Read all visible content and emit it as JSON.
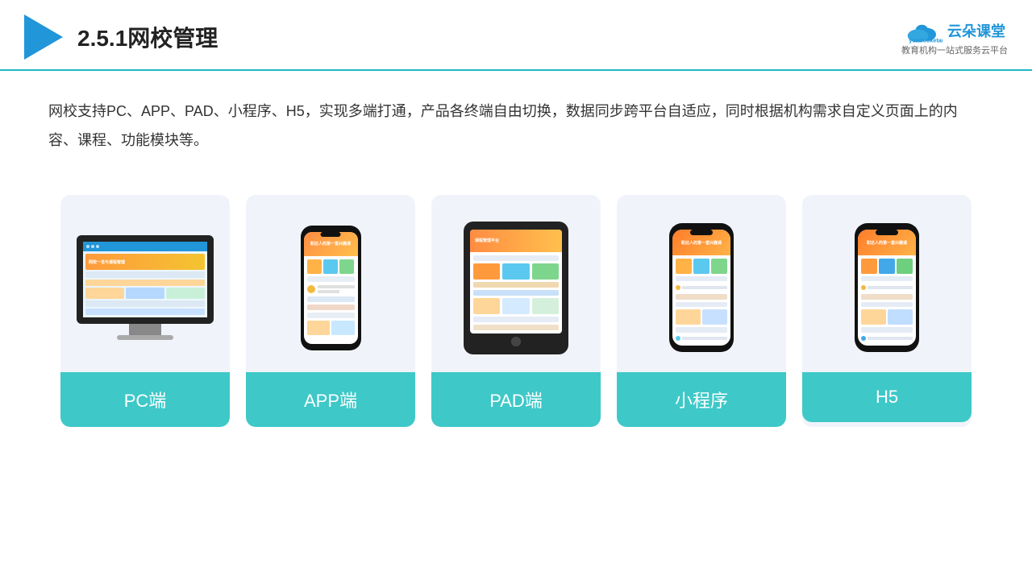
{
  "header": {
    "title": "2.5.1网校管理",
    "brand_name": "云朵课堂",
    "brand_url": "yunduoketang.com",
    "brand_tagline": "教育机构一站\n式服务云平台"
  },
  "description": "网校支持PC、APP、PAD、小程序、H5，实现多端打通，产品各终端自由切换，数据同步跨平台自适应，同时根据机构需求自定义页面上的内容、课程、功能模块等。",
  "cards": [
    {
      "id": "pc",
      "label": "PC端"
    },
    {
      "id": "app",
      "label": "APP端"
    },
    {
      "id": "pad",
      "label": "PAD端"
    },
    {
      "id": "miniprogram",
      "label": "小程序"
    },
    {
      "id": "h5",
      "label": "H5"
    }
  ],
  "colors": {
    "accent": "#3ec8c8",
    "primary_blue": "#2196d8",
    "header_line": "#1db8c8"
  }
}
